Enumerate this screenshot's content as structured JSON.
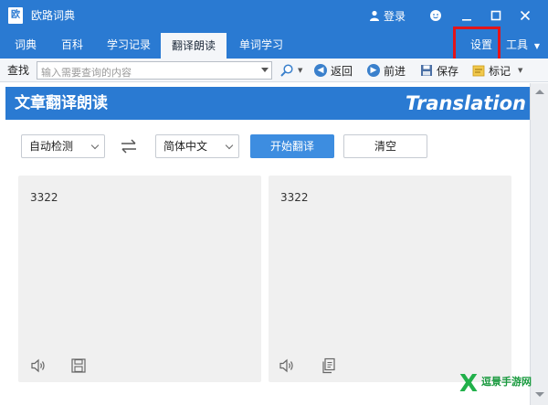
{
  "window": {
    "app_icon_text": "欧",
    "title": "欧路词典",
    "login_label": "登录"
  },
  "menubar": {
    "tabs": [
      {
        "label": "词典"
      },
      {
        "label": "百科"
      },
      {
        "label": "学习记录"
      },
      {
        "label": "翻译朗读",
        "active": true
      },
      {
        "label": "单词学习"
      }
    ],
    "settings_label": "设置",
    "tools_label": "工具"
  },
  "toolbar": {
    "search_label": "查找",
    "search_placeholder": "输入需要查询的内容",
    "back_label": "返回",
    "forward_label": "前进",
    "save_label": "保存",
    "mark_label": "标记"
  },
  "translation": {
    "header_title": "文章翻译朗读",
    "header_brand": "Translation",
    "source_lang": "自动检测",
    "target_lang": "简体中文",
    "translate_button": "开始翻译",
    "clear_button": "清空",
    "source_text": "3322",
    "result_text": "3322"
  },
  "watermark": {
    "mark": "X",
    "text": "逗景手游网"
  },
  "colors": {
    "brand_blue": "#2a7ad2",
    "button_blue": "#3d8de0",
    "highlight_red": "#e3141a",
    "panel_gray": "#f0f0f0"
  }
}
